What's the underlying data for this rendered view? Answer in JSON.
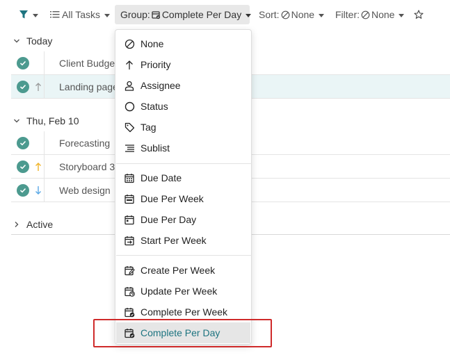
{
  "toolbar": {
    "all_tasks": "All Tasks",
    "group_prefix": "Group:",
    "group_value": "Complete Per Day",
    "sort_prefix": "Sort:",
    "sort_value": "None",
    "filter_prefix": "Filter:",
    "filter_value": "None"
  },
  "sections": {
    "today": "Today",
    "thu": "Thu, Feb 10",
    "active": "Active"
  },
  "rows": [
    {
      "title": "Client Budget",
      "priority": ""
    },
    {
      "title": "Landing page",
      "priority": "up-gray"
    },
    {
      "title": "Forecasting",
      "priority": ""
    },
    {
      "title": "Storyboard 3",
      "priority": "up-yellow"
    },
    {
      "title": "Web design",
      "priority": "down-blue"
    }
  ],
  "menu": {
    "items": [
      {
        "label": "None",
        "icon": "none-icon"
      },
      {
        "label": "Priority",
        "icon": "arrow-up-icon"
      },
      {
        "label": "Assignee",
        "icon": "person-icon"
      },
      {
        "label": "Status",
        "icon": "circle-icon"
      },
      {
        "label": "Tag",
        "icon": "tag-icon"
      },
      {
        "label": "Sublist",
        "icon": "sublist-icon"
      },
      {
        "label": "Due Date",
        "icon": "calendar-icon"
      },
      {
        "label": "Due Per Week",
        "icon": "calendar-week-icon"
      },
      {
        "label": "Due Per Day",
        "icon": "calendar-day-icon"
      },
      {
        "label": "Start Per Week",
        "icon": "calendar-start-icon"
      },
      {
        "label": "Create Per Week",
        "icon": "calendar-edit-icon"
      },
      {
        "label": "Update Per Week",
        "icon": "calendar-refresh-icon"
      },
      {
        "label": "Complete Per Week",
        "icon": "calendar-check-icon"
      },
      {
        "label": "Complete Per Day",
        "icon": "calendar-check-icon"
      }
    ]
  },
  "colors": {
    "accent": "#1d7480",
    "check": "#4c9a8f",
    "highlight_box": "#cf2a2a",
    "priority_yellow": "#f0b429",
    "priority_blue": "#5aa9e6"
  }
}
